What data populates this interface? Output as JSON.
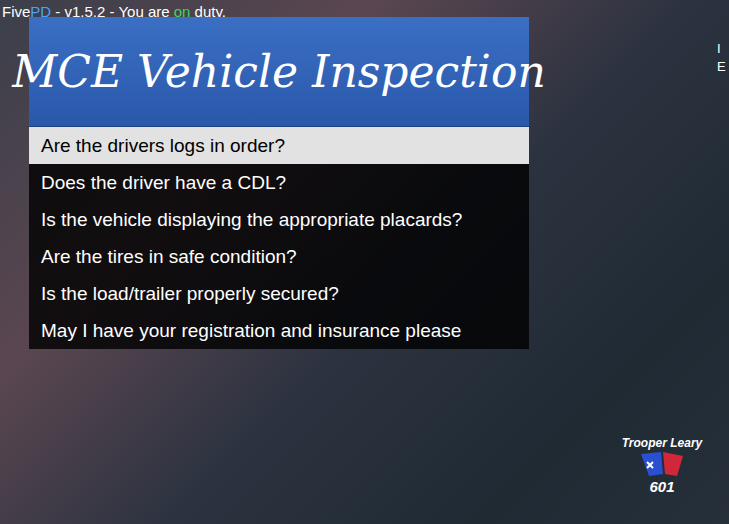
{
  "hud": {
    "prefix": "Five",
    "prefix_accent": "PD",
    "middle": " - v1.5.2 - You are ",
    "status": "on",
    "suffix": " duty."
  },
  "menu": {
    "title": "MCE Vehicle Inspection",
    "items": [
      {
        "label": "Are the drivers logs in order?",
        "selected": true
      },
      {
        "label": "Does the driver have a CDL?",
        "selected": false
      },
      {
        "label": "Is the vehicle displaying the appropriate placards?",
        "selected": false
      },
      {
        "label": "Are the tires in safe condition?",
        "selected": false
      },
      {
        "label": "Is the load/trailer properly secured?",
        "selected": false
      },
      {
        "label": "May I have your registration and insurance please",
        "selected": false
      }
    ]
  },
  "side_text": [
    "I",
    "E"
  ],
  "badge": {
    "name": "Trooper Leary",
    "number": "601"
  }
}
